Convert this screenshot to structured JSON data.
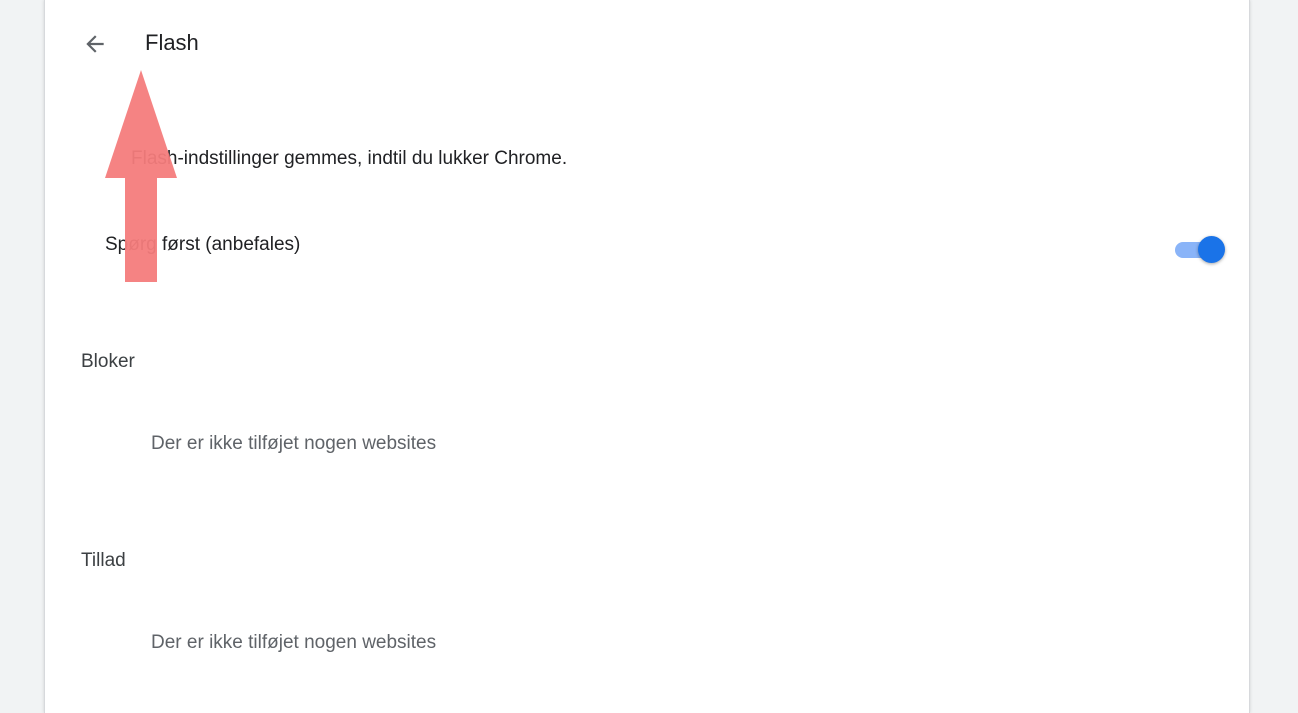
{
  "header": {
    "back_icon": "arrow-left-icon",
    "title": "Flash"
  },
  "info": {
    "text": "Flash-indstillinger gemmes, indtil du lukker Chrome."
  },
  "ask_first": {
    "label": "Spørg først (anbefales)",
    "enabled": true
  },
  "sections": {
    "block": {
      "heading": "Bloker",
      "empty_text": "Der er ikke tilføjet nogen websites"
    },
    "allow": {
      "heading": "Tillad",
      "empty_text": "Der er ikke tilføjet nogen websites"
    }
  },
  "colors": {
    "accent": "#1a73e8",
    "toggle_track": "#8ab4f8",
    "annotation_arrow": "#f47c7c"
  }
}
